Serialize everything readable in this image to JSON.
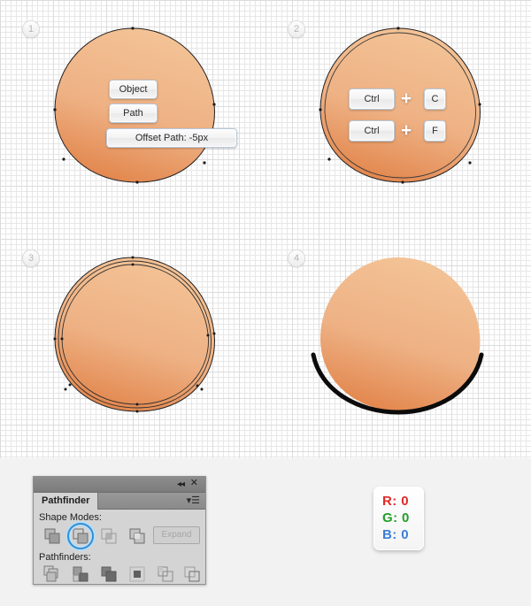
{
  "canvas": {
    "grid": "graph-paper",
    "background_color": "#ffffff",
    "grid_color": "#e7e7e7"
  },
  "shape": {
    "fill_top_color": "#f3c396",
    "fill_bottom_color": "#e2844a",
    "stroke_color": "#231f20"
  },
  "steps": [
    {
      "number": "1",
      "name": "offset-path-step",
      "menu_items": [
        {
          "label": "Object"
        },
        {
          "label": "Path"
        },
        {
          "label": "Offset Path: -5px"
        }
      ]
    },
    {
      "number": "2",
      "name": "copy-paste-front-step",
      "shortcuts": [
        {
          "modifier": "Ctrl",
          "plus": "+",
          "key": "C"
        },
        {
          "modifier": "Ctrl",
          "plus": "+",
          "key": "F"
        }
      ]
    },
    {
      "number": "3",
      "name": "duplicated-paths-step"
    },
    {
      "number": "4",
      "name": "minus-front-result-step"
    }
  ],
  "pathfinder": {
    "title": "Pathfinder",
    "collapse_icon": "collapse-chevrons-icon",
    "close_icon": "close-icon",
    "menu_icon": "panel-menu-icon",
    "shape_modes_label": "Shape Modes:",
    "pathfinders_label": "Pathfinders:",
    "expand_label": "Expand",
    "expand_enabled": false,
    "selected_shape_mode_index": 1,
    "selection_color": "#2f8fd8",
    "shape_modes": [
      {
        "name": "unite-icon"
      },
      {
        "name": "minus-front-icon"
      },
      {
        "name": "intersect-icon"
      },
      {
        "name": "exclude-icon"
      }
    ],
    "pathfinders": [
      {
        "name": "divide-icon"
      },
      {
        "name": "trim-icon"
      },
      {
        "name": "merge-icon"
      },
      {
        "name": "crop-icon"
      },
      {
        "name": "outline-icon"
      },
      {
        "name": "minus-back-icon"
      }
    ]
  },
  "color_card": {
    "name": "rgb-values-card",
    "lines": [
      {
        "channel": "R:",
        "value": "0",
        "color": "#e02b28"
      },
      {
        "channel": "G:",
        "value": "0",
        "color": "#22a02a"
      },
      {
        "channel": "B:",
        "value": "0",
        "color": "#3b7fd4"
      }
    ]
  }
}
